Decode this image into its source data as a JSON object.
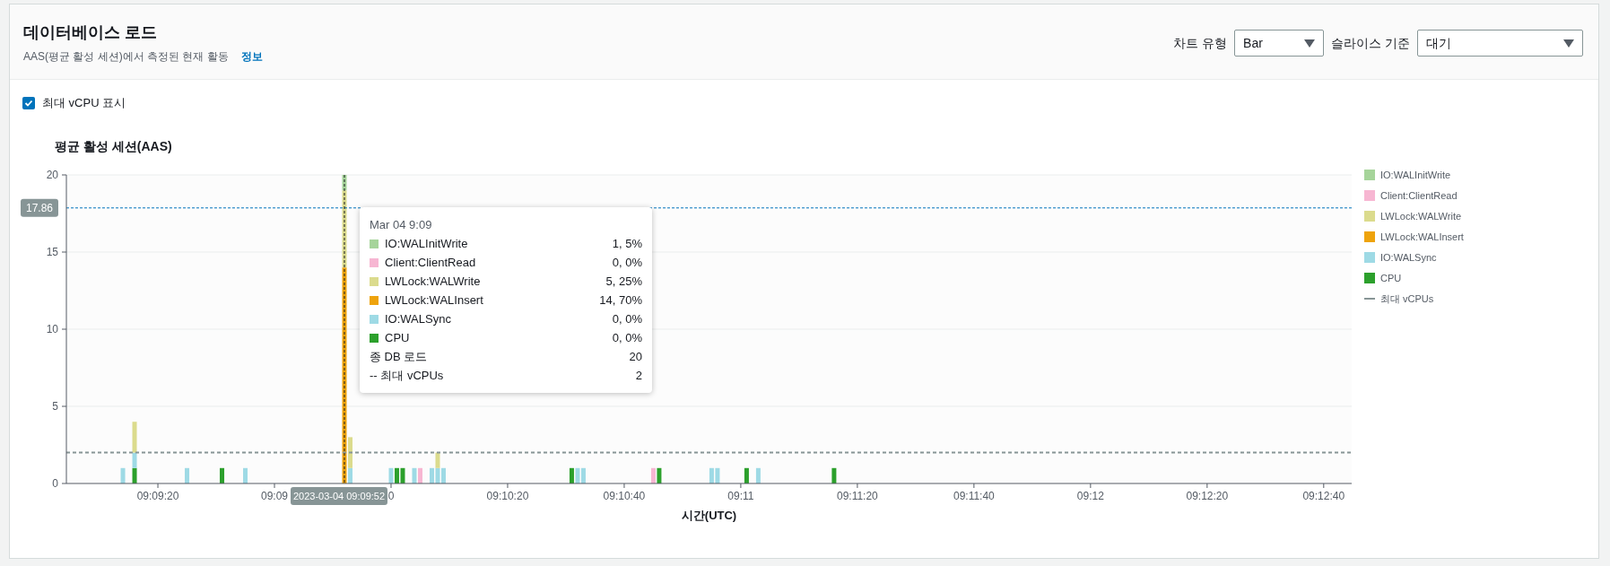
{
  "header": {
    "title": "데이터베이스 로드",
    "subtitle": "AAS(평균 활성 세션)에서 측정된 현재 활동",
    "info_link": "정보",
    "controls": [
      {
        "label": "차트 유형",
        "value": "Bar"
      },
      {
        "label": "슬라이스 기준",
        "value": "대기"
      }
    ]
  },
  "show_max_vcpu": {
    "label": "최대 vCPU 표시",
    "checked": true
  },
  "chart": {
    "chart_data": {
      "type": "bar",
      "stacked": true,
      "grid": true,
      "title": "평균 활성 세션(AAS)",
      "xlabel": "시간(UTC)",
      "x": [
        32954,
        32956,
        32965,
        32971,
        32975,
        32992,
        32993,
        33000,
        33001,
        33002,
        33004,
        33005,
        33007,
        33008,
        33009,
        33031,
        33032,
        33033,
        33045,
        33046,
        33055,
        33056,
        33061,
        33063,
        33076
      ],
      "series": [
        {
          "name": "IO:WALInitWrite",
          "color": "#a6d49a",
          "values": [
            0,
            0,
            0,
            0,
            0,
            1,
            0,
            0,
            0,
            0,
            0,
            0,
            0,
            0,
            0,
            0,
            0,
            0,
            0,
            0,
            0,
            0,
            0,
            0,
            0
          ]
        },
        {
          "name": "Client:ClientRead",
          "color": "#f7b6d2",
          "values": [
            0,
            0,
            0,
            0,
            0,
            0,
            0,
            0,
            0,
            0,
            0,
            1,
            0,
            0,
            0,
            0,
            0,
            0,
            1,
            0,
            0,
            0,
            0,
            0,
            0
          ]
        },
        {
          "name": "LWLock:WALWrite",
          "color": "#dbdb8d",
          "values": [
            0,
            2,
            0,
            0,
            0,
            5,
            2,
            0,
            0,
            0,
            0,
            0,
            0,
            1,
            0,
            0,
            0,
            0,
            0,
            0,
            0,
            0,
            0,
            0,
            0
          ]
        },
        {
          "name": "LWLock:WALInsert",
          "color": "#eea30c",
          "values": [
            0,
            0,
            0,
            0,
            0,
            14,
            0,
            0,
            0,
            0,
            0,
            0,
            0,
            0,
            0,
            0,
            0,
            0,
            0,
            0,
            0,
            0,
            0,
            0,
            0
          ]
        },
        {
          "name": "IO:WALSync",
          "color": "#9edae5",
          "values": [
            1,
            1,
            1,
            0,
            1,
            0,
            1,
            1,
            0,
            0,
            1,
            0,
            1,
            1,
            1,
            0,
            1,
            1,
            0,
            0,
            1,
            1,
            0,
            1,
            0
          ]
        },
        {
          "name": "CPU",
          "color": "#2ca02c",
          "values": [
            0,
            1,
            0,
            1,
            0,
            0,
            0,
            0,
            1,
            1,
            0,
            0,
            0,
            0,
            0,
            1,
            0,
            0,
            0,
            1,
            0,
            0,
            1,
            0,
            1
          ]
        }
      ],
      "xlim": [
        32944.3,
        33164.8
      ],
      "ylim": [
        0,
        20
      ],
      "yticks": [
        0,
        5,
        10,
        15,
        20
      ],
      "xticks": [
        {
          "value": 32960,
          "label": "09:09:20"
        },
        {
          "value": 33020,
          "label": "09:10:20"
        },
        {
          "value": 33040,
          "label": "09:10:40"
        },
        {
          "value": 33060,
          "label": "09:11"
        },
        {
          "value": 33080,
          "label": "09:11:20"
        },
        {
          "value": 33100,
          "label": "09:11:40"
        },
        {
          "value": 33120,
          "label": "09:12"
        },
        {
          "value": 33140,
          "label": "09:12:20"
        },
        {
          "value": 33160,
          "label": "09:12:40"
        }
      ],
      "ref_lines": [
        {
          "axis": "y",
          "value": 2,
          "color": "#879596"
        },
        {
          "axis": "y",
          "value": 17.86,
          "label": "17.86",
          "color": "#0073bb"
        },
        {
          "axis": "x",
          "value": 32992,
          "color": "#16191f"
        }
      ]
    },
    "partial_tick_labels": [
      "09:09",
      "0"
    ],
    "hover_time_label": "2023-03-04 09:09:52",
    "max_vcpu_legend": "최대 vCPUs",
    "tooltip": {
      "title": "Mar 04 9:09",
      "rows": [
        {
          "label": "IO:WALInitWrite",
          "value": "1, 5%",
          "color": "#a6d49a",
          "kind": "swatch"
        },
        {
          "label": "Client:ClientRead",
          "value": "0, 0%",
          "color": "#f7b6d2",
          "kind": "swatch"
        },
        {
          "label": "LWLock:WALWrite",
          "value": "5, 25%",
          "color": "#dbdb8d",
          "kind": "swatch"
        },
        {
          "label": "LWLock:WALInsert",
          "value": "14, 70%",
          "color": "#eea30c",
          "kind": "swatch"
        },
        {
          "label": "IO:WALSync",
          "value": "0, 0%",
          "color": "#9edae5",
          "kind": "swatch"
        },
        {
          "label": "CPU",
          "value": "0, 0%",
          "color": "#2ca02c",
          "kind": "swatch"
        },
        {
          "label": "종 DB 로드",
          "value": "20",
          "kind": "plain"
        },
        {
          "label": "-- 최대 vCPUs",
          "value": "2",
          "kind": "plain"
        }
      ]
    }
  }
}
